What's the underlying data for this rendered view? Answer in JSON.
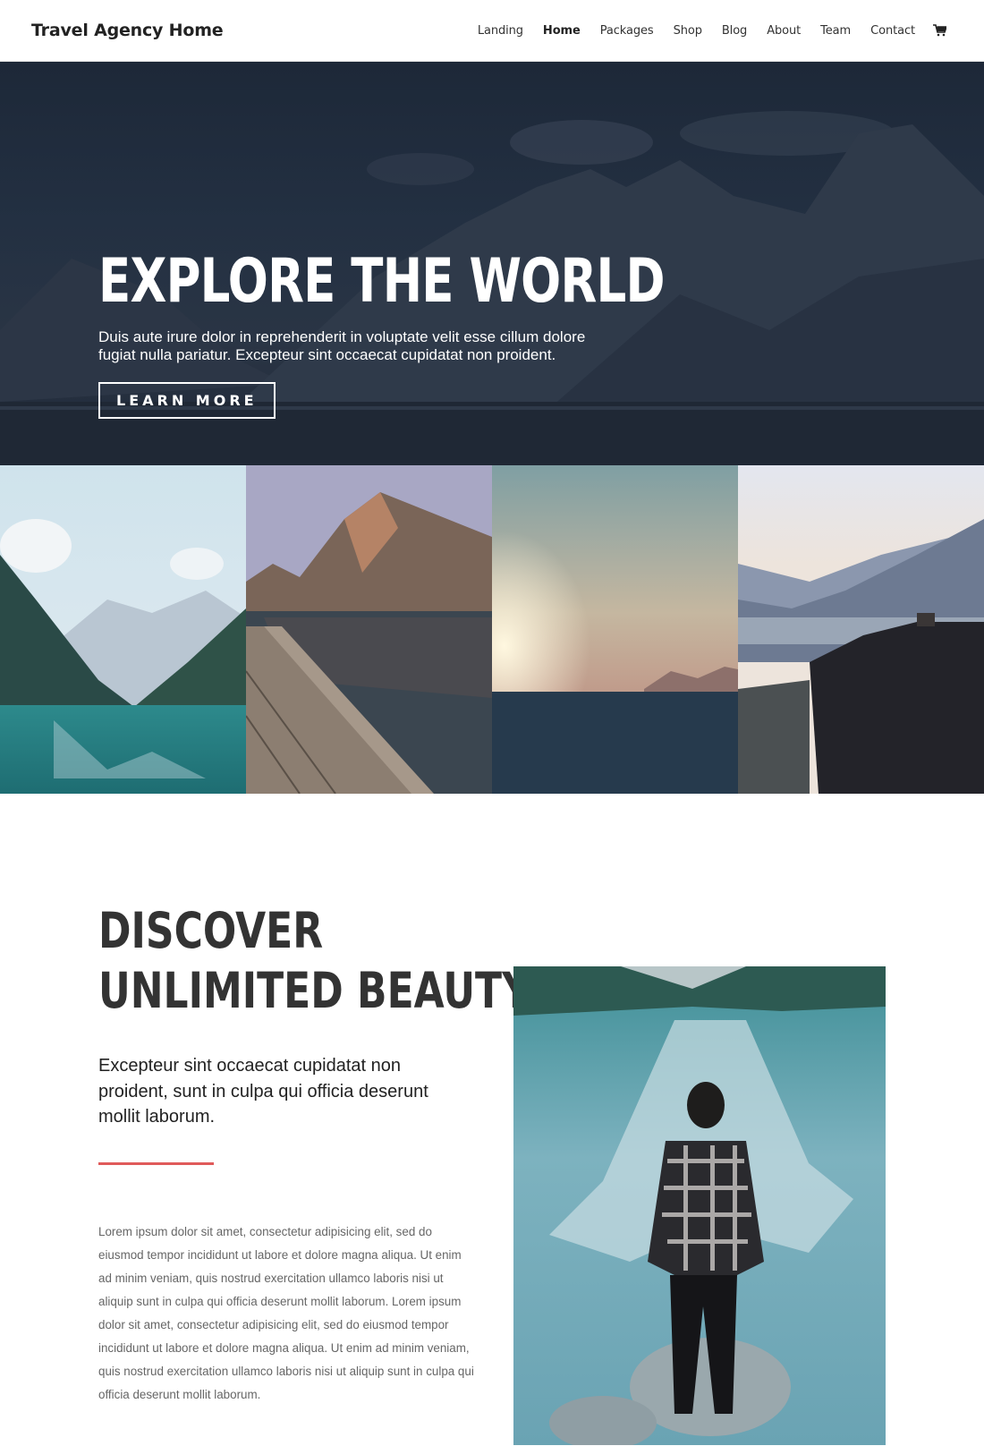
{
  "header": {
    "logo": "Travel Agency Home",
    "nav": [
      {
        "label": "Landing",
        "active": false
      },
      {
        "label": "Home",
        "active": true
      },
      {
        "label": "Packages",
        "active": false
      },
      {
        "label": "Shop",
        "active": false
      },
      {
        "label": "Blog",
        "active": false
      },
      {
        "label": "About",
        "active": false
      },
      {
        "label": "Team",
        "active": false
      },
      {
        "label": "Contact",
        "active": false
      }
    ],
    "cart_icon": "shopping-cart-icon"
  },
  "hero": {
    "title": "EXPLORE THE WORLD",
    "subtitle_line1": "Duis aute irure dolor in reprehenderit in voluptate velit esse cillum dolore",
    "subtitle_line2": "fugiat nulla pariatur. Excepteur sint occaecat cupidatat non proident.",
    "button_label": "LEARN MORE",
    "background": "dark mountain lake landscape"
  },
  "gallery": [
    {
      "name": "lake-valley-photo",
      "description": "turquoise lake between mountains"
    },
    {
      "name": "mountain-dock-photo",
      "description": "wooden dock with mountain reflection"
    },
    {
      "name": "sunset-sea-photo",
      "description": "sun over misty sea"
    },
    {
      "name": "river-gorge-photo",
      "description": "river gorge with cliff"
    }
  ],
  "discover": {
    "title_line1": "DISCOVER",
    "title_line2": "UNLIMITED BEAUTY",
    "lead": "Excepteur sint occaecat cupidatat non proident, sunt in culpa qui officia deserunt mollit laborum.",
    "body": "Lorem ipsum dolor sit amet, consectetur adipisicing elit, sed do eiusmod tempor incididunt ut labore et dolore magna aliqua. Ut enim ad minim veniam, quis nostrud exercitation ullamco laboris nisi ut aliquip sunt in culpa qui officia deserunt mollit laborum. Lorem ipsum dolor sit amet, consectetur adipisicing elit, sed do eiusmod tempor incididunt ut labore et dolore magna aliqua. Ut enim ad minim veniam, quis nostrud exercitation ullamco laboris nisi ut aliquip sunt in culpa qui officia deserunt mollit laborum.",
    "image": "man standing on rock facing mountain lake",
    "accent_color": "#e05a5a"
  }
}
